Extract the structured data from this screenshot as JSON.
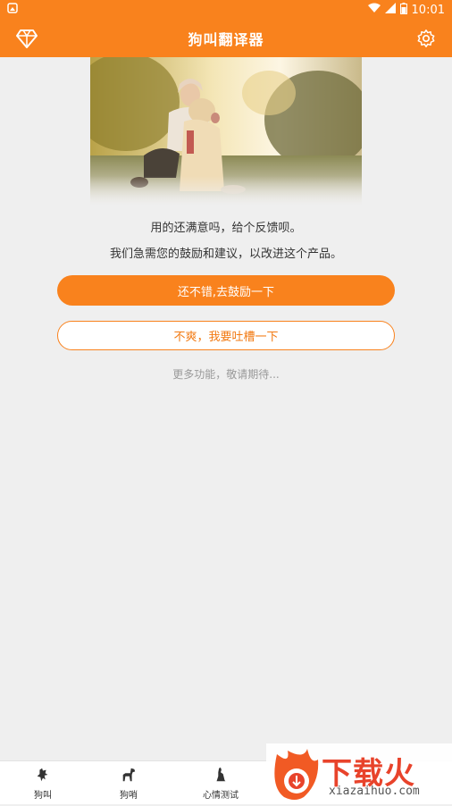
{
  "status_bar": {
    "time": "10:01"
  },
  "app_bar": {
    "title": "狗叫翻译器"
  },
  "main": {
    "message_line1": "用的还满意吗，给个反馈呗。",
    "message_line2": "我们急需您的鼓励和建议，以改进这个产品。",
    "primary_button": "还不错,去鼓励一下",
    "secondary_button": "不爽，我要吐槽一下",
    "more_text": "更多功能，敬请期待..."
  },
  "bottom_nav": {
    "items": [
      {
        "label": "狗叫",
        "icon": "dog-bark-icon"
      },
      {
        "label": "狗哨",
        "icon": "dog-whistle-icon"
      },
      {
        "label": "心情测试",
        "icon": "dog-sit-icon"
      }
    ]
  },
  "watermark": {
    "text": "下载火",
    "sub": "xiazaihuo.com"
  },
  "colors": {
    "accent": "#f9821d",
    "background": "#efefef"
  }
}
